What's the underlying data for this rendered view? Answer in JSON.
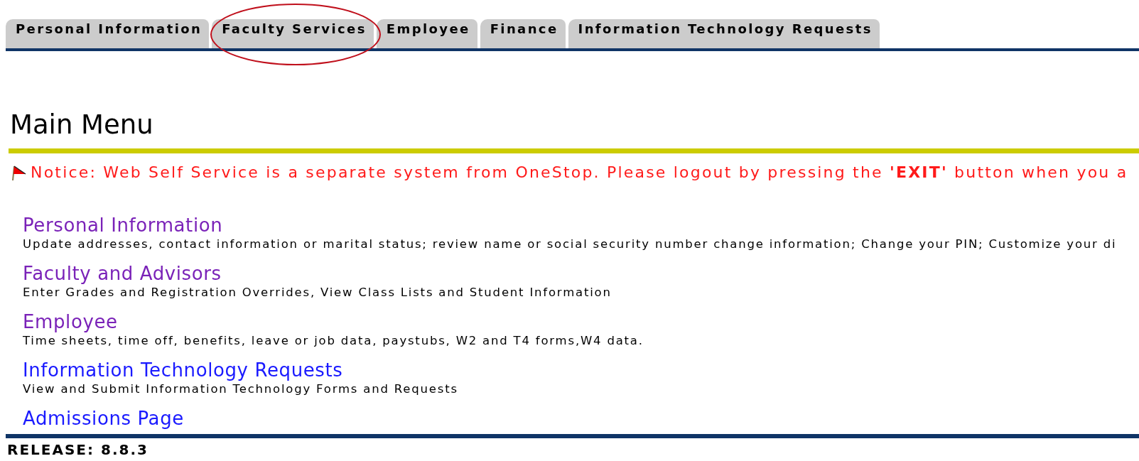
{
  "tabs": [
    {
      "label": "Personal Information",
      "selected": false,
      "circled": false
    },
    {
      "label": "Faculty Services",
      "selected": false,
      "circled": true
    },
    {
      "label": "Employee",
      "selected": false,
      "circled": false
    },
    {
      "label": "Finance",
      "selected": false,
      "circled": false
    },
    {
      "label": "Information Technology Requests",
      "selected": false,
      "circled": false
    }
  ],
  "page_title": "Main Menu",
  "notice": "Notice: Web Self Service is a separate system from OneStop. Please logout by pressing the **'EXIT'** button when you a",
  "menu_items": [
    {
      "link": "Personal Information",
      "visited": true,
      "description": "Update addresses, contact information or marital status; review name or social security number change information; Change your PIN; Customize your di"
    },
    {
      "link": "Faculty and Advisors",
      "visited": true,
      "description": "Enter Grades and Registration Overrides, View Class Lists and Student Information"
    },
    {
      "link": "Employee",
      "visited": true,
      "description": "Time sheets, time off, benefits, leave or job data, paystubs, W2 and T4 forms,W4 data."
    },
    {
      "link": "Information Technology Requests",
      "visited": false,
      "description": "View and Submit Information Technology Forms and Requests"
    },
    {
      "link": "Admissions Page",
      "visited": false
    }
  ],
  "release": "RELEASE: 8.8.3"
}
